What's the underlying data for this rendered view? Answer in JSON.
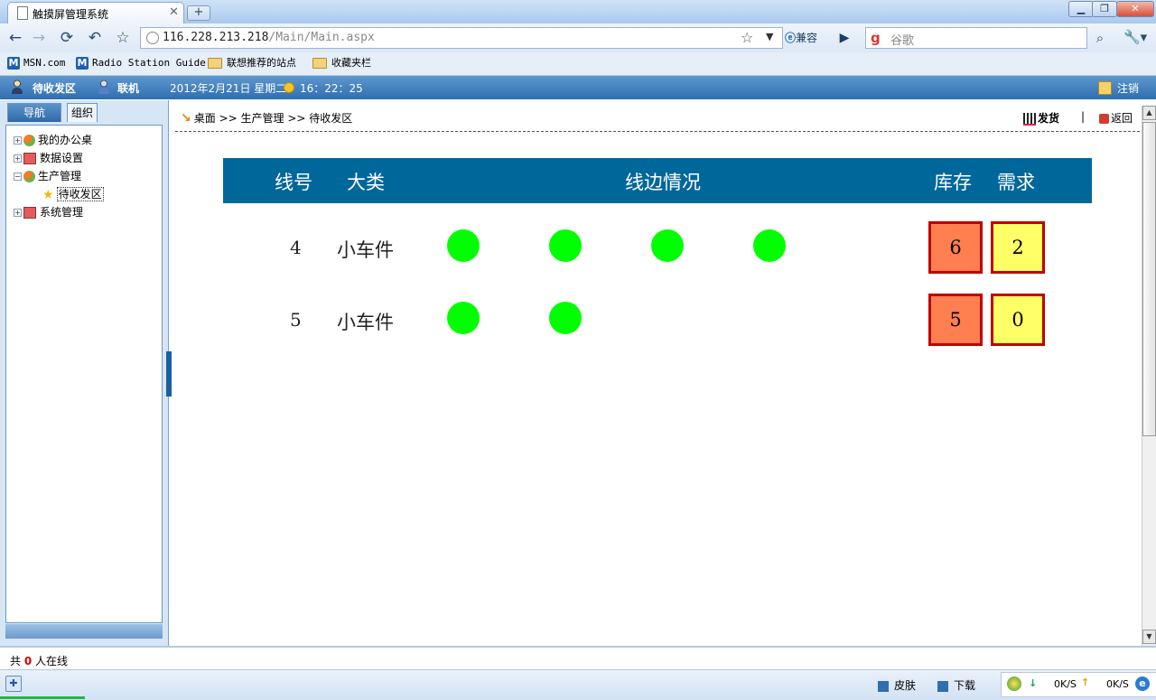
{
  "browser": {
    "tab_title": "触摸屏管理系统",
    "url_host": "116.228.213.218",
    "url_path": "/Main/Main.aspx",
    "compat_label": "兼容",
    "search_placeholder": "谷歌",
    "bookmarks": [
      "MSN.com",
      "Radio Station Guide",
      "联想推荐的站点",
      "收藏夹栏"
    ]
  },
  "header": {
    "user": "待收发区",
    "link": "联机",
    "date": "2012年2月21日 星期二",
    "time": "16：22：25",
    "logout": "注销"
  },
  "left_panel": {
    "tabs": [
      "导航",
      "组织"
    ],
    "tree": [
      {
        "label": "我的办公桌",
        "icon": "flower-icon",
        "expanded": false
      },
      {
        "label": "数据设置",
        "icon": "book-icon",
        "expanded": false
      },
      {
        "label": "生产管理",
        "icon": "flower-icon",
        "expanded": true
      },
      {
        "label": "待收发区",
        "icon": "star-icon",
        "child": true,
        "selected": true
      },
      {
        "label": "系统管理",
        "icon": "book-icon",
        "expanded": false
      }
    ]
  },
  "content": {
    "breadcrumb": [
      "桌面",
      "生产管理",
      "待收发区"
    ],
    "breadcrumb_sep": ">>",
    "ship_label": "发货",
    "divider": "|",
    "back_label": "返回",
    "table": {
      "headers": {
        "line": "线号",
        "category": "大类",
        "status": "线边情况",
        "stock": "库存",
        "demand": "需求"
      },
      "rows": [
        {
          "line": "4",
          "category": "小车件",
          "dots": 4,
          "stock": "6",
          "demand": "2"
        },
        {
          "line": "5",
          "category": "小车件",
          "dots": 2,
          "stock": "5",
          "demand": "0"
        }
      ],
      "colors": {
        "header_bg": "#00679b",
        "dot": "#00ff00",
        "stock_bg": "#ff7f50",
        "demand_bg": "#ffff66",
        "box_border": "#c00000"
      }
    }
  },
  "footer": {
    "online_prefix": "共",
    "online_count": "0",
    "online_suffix": "人在线"
  },
  "statusbar": {
    "skin": "皮肤",
    "download": "下载",
    "down_rate": "0K/S",
    "up_rate": "0K/S"
  }
}
